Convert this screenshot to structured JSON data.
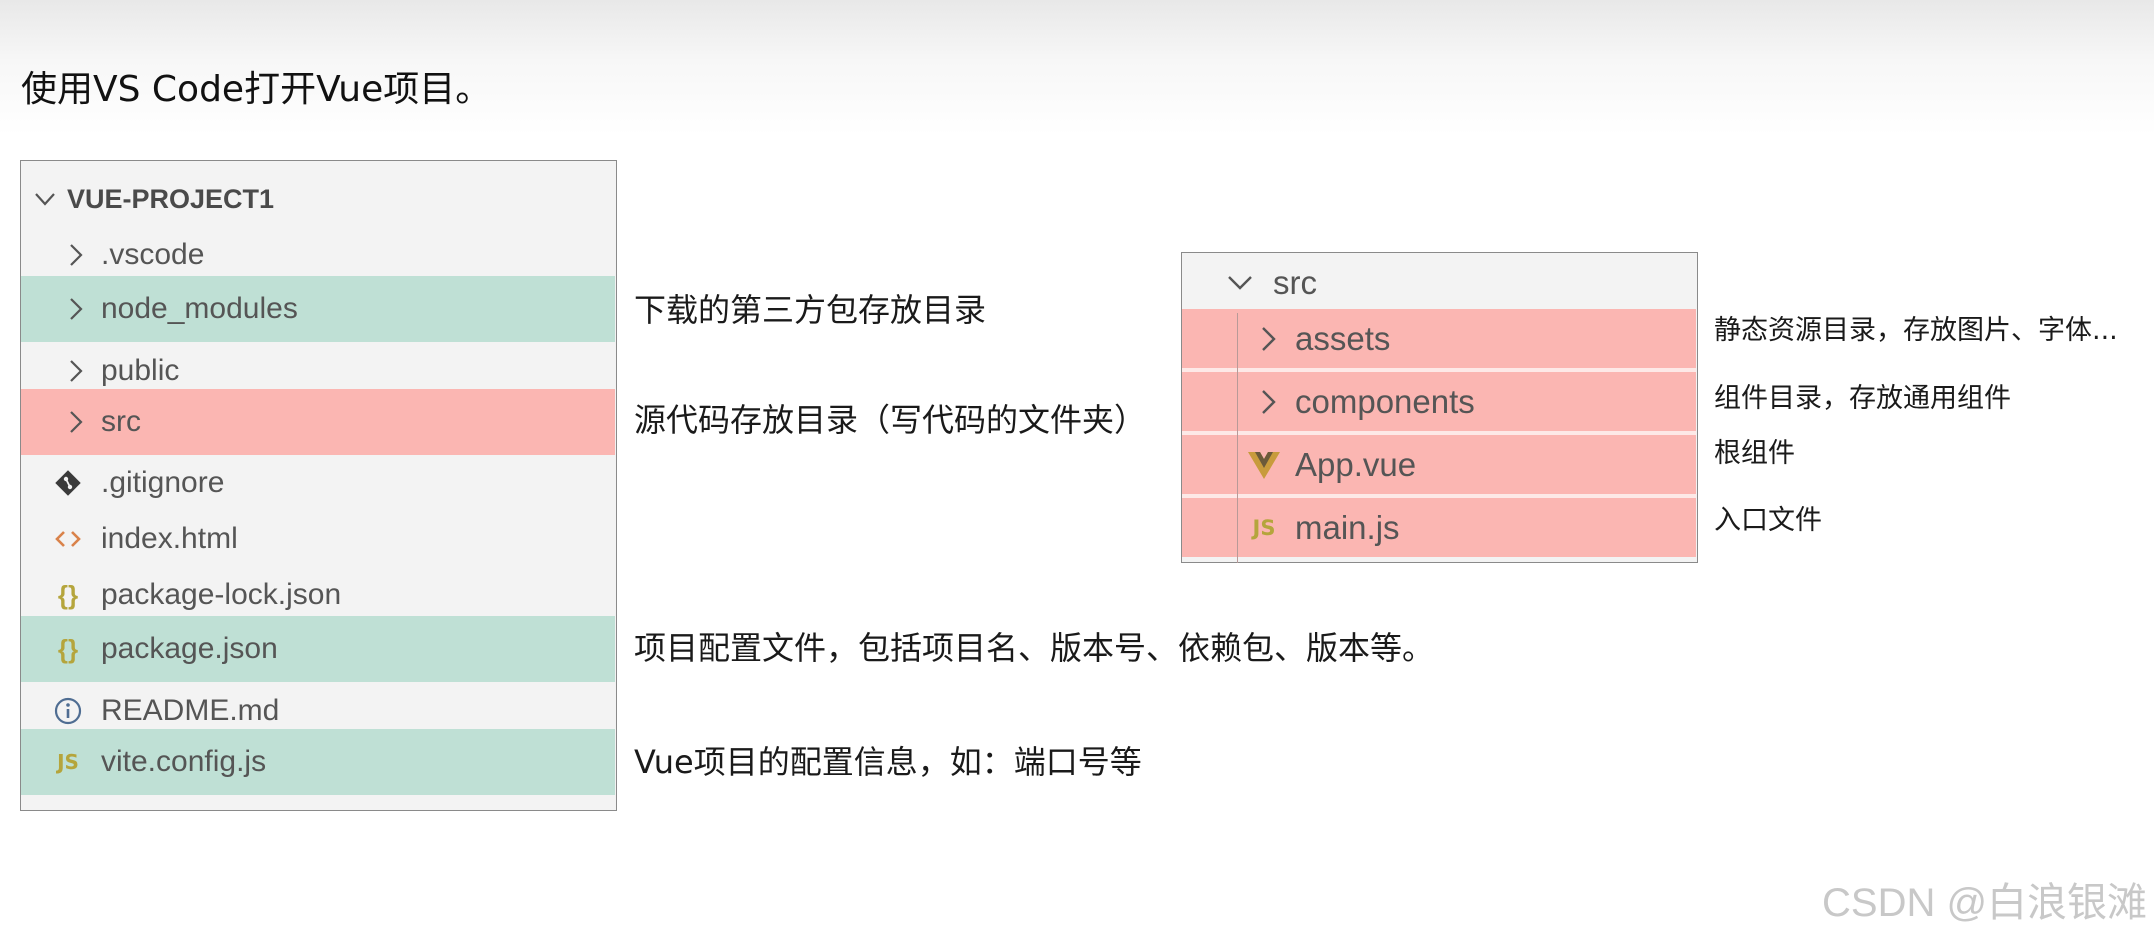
{
  "page": {
    "title": "使用VS Code打开Vue项目。"
  },
  "explorer": {
    "root_label": "VUE-PROJECT1",
    "items": [
      {
        "label": ".vscode",
        "icon": "chevron-right-icon"
      },
      {
        "label": "node_modules",
        "icon": "chevron-right-icon"
      },
      {
        "label": "public",
        "icon": "chevron-right-icon"
      },
      {
        "label": "src",
        "icon": "chevron-right-icon"
      },
      {
        "label": ".gitignore",
        "icon": "git-icon"
      },
      {
        "label": "index.html",
        "icon": "html-icon"
      },
      {
        "label": "package-lock.json",
        "icon": "json-braces-icon"
      },
      {
        "label": "package.json",
        "icon": "json-braces-icon"
      },
      {
        "label": "README.md",
        "icon": "info-icon"
      },
      {
        "label": "vite.config.js",
        "icon": "js-icon"
      }
    ]
  },
  "explanations": {
    "node_modules": "下载的第三方包存放目录",
    "src": "源代码存放目录（写代码的文件夹）",
    "package_json": "项目配置文件，包括项目名、版本号、依赖包、版本等。",
    "vite_config": "Vue项目的配置信息，如：端口号等"
  },
  "src_panel": {
    "folder_label": "src",
    "items": [
      {
        "label": "assets",
        "icon": "chevron-right-icon",
        "note": "静态资源目录，存放图片、字体..."
      },
      {
        "label": "components",
        "icon": "chevron-right-icon",
        "note": "组件目录，存放通用组件"
      },
      {
        "label": "App.vue",
        "icon": "vue-icon",
        "note": "根组件"
      },
      {
        "label": "main.js",
        "icon": "js-icon",
        "note": "入口文件"
      }
    ]
  },
  "watermark": "CSDN @白浪银滩",
  "colors": {
    "highlight_green": "#bfe0d5",
    "highlight_red": "#fbb6b2",
    "json_icon": "#b5a53c",
    "js_icon": "#b5a53c",
    "html_icon": "#d9824a",
    "vue_icon": "#c89b3c"
  }
}
